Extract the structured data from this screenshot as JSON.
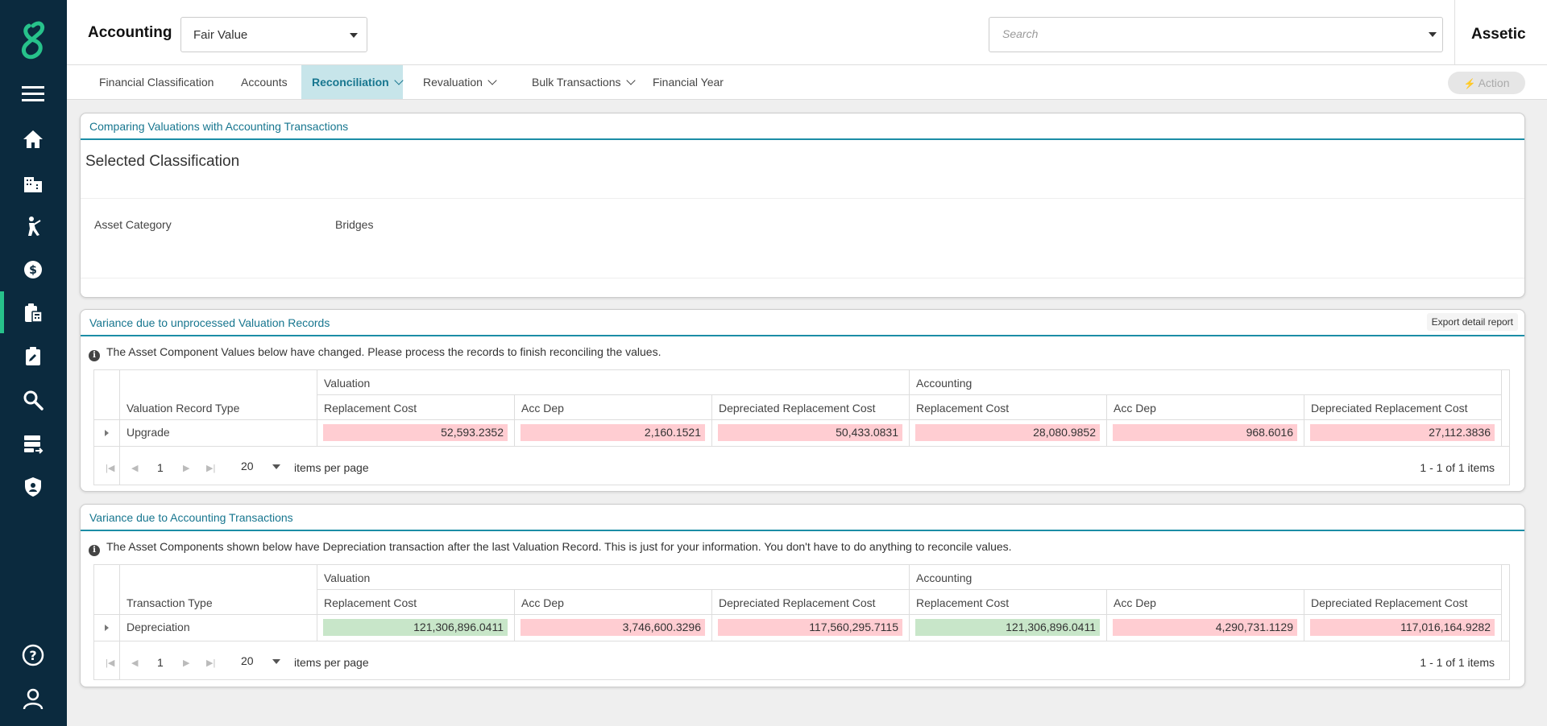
{
  "header": {
    "module_title": "Accounting",
    "module_select_value": "Fair Value",
    "search_placeholder": "Search",
    "brand": "Assetic"
  },
  "tabs": [
    {
      "label": "Financial Classification"
    },
    {
      "label": "Accounts"
    },
    {
      "label": "Reconciliation"
    },
    {
      "label": "Revaluation"
    },
    {
      "label": "Bulk Transactions"
    },
    {
      "label": "Financial Year"
    }
  ],
  "action_label": "Action",
  "classification_panel": {
    "header": "Comparing Valuations with Accounting Transactions",
    "title": "Selected Classification",
    "field_label": "Asset Category",
    "field_value": "Bridges"
  },
  "valuation_panel": {
    "header": "Variance due to unprocessed Valuation Records",
    "export_label": "Export detail report",
    "info": "The Asset Component Values below have changed. Please process the records to finish reconciling the values.",
    "group_valuation": "Valuation",
    "group_accounting": "Accounting",
    "first_col": "Valuation Record Type",
    "cols": [
      "Replacement Cost",
      "Acc Dep",
      "Depreciated Replacement Cost",
      "Replacement Cost",
      "Acc Dep",
      "Depreciated Replacement Cost"
    ],
    "row_label": "Upgrade",
    "row_values": [
      "52,593.2352",
      "2,160.1521",
      "50,433.0831",
      "28,080.9852",
      "968.6016",
      "27,112.3836"
    ],
    "page": "1",
    "page_size": "20",
    "items_per_page": "items per page",
    "range": "1 - 1 of 1 items"
  },
  "transactions_panel": {
    "header": "Variance due to Accounting Transactions",
    "info": "The Asset Components shown below have Depreciation transaction after the last Valuation Record. This is just for your information. You don't have to do anything to reconcile values.",
    "group_valuation": "Valuation",
    "group_accounting": "Accounting",
    "first_col": "Transaction Type",
    "cols": [
      "Replacement Cost",
      "Acc Dep",
      "Depreciated Replacement Cost",
      "Replacement Cost",
      "Acc Dep",
      "Depreciated Replacement Cost"
    ],
    "row_label": "Depreciation",
    "row_values": [
      "121,306,896.0411",
      "3,746,600.3296",
      "117,560,295.7115",
      "121,306,896.0411",
      "4,290,731.1129",
      "117,016,164.9282"
    ],
    "page": "1",
    "page_size": "20",
    "items_per_page": "items per page",
    "range": "1 - 1 of 1 items"
  },
  "colors": {
    "sidebar": "#0b2a3e",
    "accent": "#1b8da6",
    "logo": "#27c28b",
    "variance_red": "#ffcdd2",
    "match_green": "#c8e6c9"
  }
}
